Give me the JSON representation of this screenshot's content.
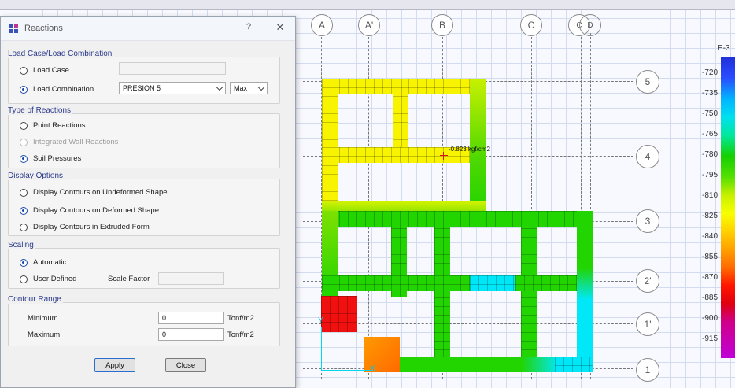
{
  "dialog": {
    "title": "Reactions",
    "help_symbol": "?",
    "close_symbol": "✕",
    "load_group": {
      "title": "Load Case/Load Combination",
      "load_case_label": "Load Case",
      "load_combination_label": "Load Combination",
      "load_combination_value": "PRESION 5",
      "max_value": "Max",
      "selected": "Load Combination"
    },
    "type_group": {
      "title": "Type of Reactions",
      "point_label": "Point Reactions",
      "wall_label": "Integrated Wall Reactions",
      "soil_label": "Soil Pressures",
      "selected": "Soil Pressures"
    },
    "display_group": {
      "title": "Display Options",
      "undeformed_label": "Display Contours on Undeformed Shape",
      "deformed_label": "Display Contours on Deformed Shape",
      "extruded_label": "Display Contours in Extruded Form",
      "selected": "Display Contours on Deformed Shape"
    },
    "scaling_group": {
      "title": "Scaling",
      "automatic_label": "Automatic",
      "user_defined_label": "User Defined",
      "scale_factor_label": "Scale Factor",
      "selected": "Automatic"
    },
    "contour_group": {
      "title": "Contour Range",
      "minimum_label": "Minimum",
      "minimum_value": "0",
      "maximum_label": "Maximum",
      "maximum_value": "0",
      "unit": "Tonf/m2"
    },
    "apply_label": "Apply",
    "close_label": "Close"
  },
  "plot": {
    "grid_columns": [
      "A",
      "A'",
      "B",
      "C",
      "C",
      "D"
    ],
    "grid_rows": [
      "5",
      "4",
      "3",
      "2'",
      "1'",
      "1"
    ],
    "annotation": "-0.823 kgf/cm2",
    "axis_y_label": "Y",
    "axis_x_label": "X"
  },
  "legend": {
    "exponent": "E-3",
    "ticks": [
      "-720",
      "-735",
      "-750",
      "-765",
      "-780",
      "-795",
      "-810",
      "-825",
      "-840",
      "-855",
      "-870",
      "-885",
      "-900",
      "-915"
    ],
    "colors": {
      "yellow": "#f8f400",
      "green": "#22d400",
      "lightgreen": "#7ee000",
      "cyan": "#00e8f8",
      "red": "#f01010",
      "orange": "#ff7a00"
    }
  }
}
